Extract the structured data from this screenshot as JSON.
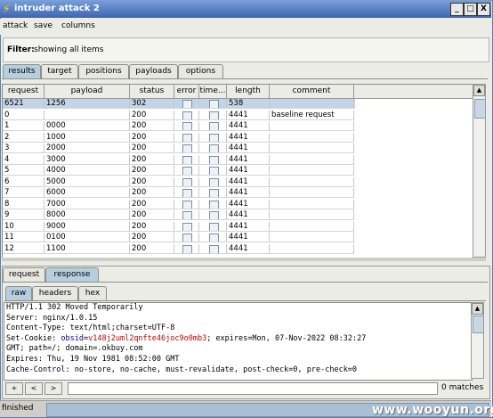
{
  "window": {
    "title": "intruder attack 2",
    "controls": [
      "_",
      "□",
      "X"
    ]
  },
  "menu": [
    "attack",
    "save",
    "columns"
  ],
  "filter": {
    "label": "Filter:",
    "value": "showing all items"
  },
  "top_tabs": [
    "results",
    "target",
    "positions",
    "payloads",
    "options"
  ],
  "active_top_tab": "results",
  "table": {
    "columns": [
      "request",
      "payload",
      "status",
      "error",
      "time...",
      "length",
      "comment"
    ],
    "rows": [
      {
        "request": "6521",
        "payload": "1256",
        "status": "302",
        "length": "538",
        "comment": "",
        "selected": true
      },
      {
        "request": "0",
        "payload": "",
        "status": "200",
        "length": "4441",
        "comment": "baseline request"
      },
      {
        "request": "1",
        "payload": "0000",
        "status": "200",
        "length": "4441",
        "comment": ""
      },
      {
        "request": "2",
        "payload": "1000",
        "status": "200",
        "length": "4441",
        "comment": ""
      },
      {
        "request": "3",
        "payload": "2000",
        "status": "200",
        "length": "4441",
        "comment": ""
      },
      {
        "request": "4",
        "payload": "3000",
        "status": "200",
        "length": "4441",
        "comment": ""
      },
      {
        "request": "5",
        "payload": "4000",
        "status": "200",
        "length": "4441",
        "comment": ""
      },
      {
        "request": "6",
        "payload": "5000",
        "status": "200",
        "length": "4441",
        "comment": ""
      },
      {
        "request": "7",
        "payload": "6000",
        "status": "200",
        "length": "4441",
        "comment": ""
      },
      {
        "request": "8",
        "payload": "7000",
        "status": "200",
        "length": "4441",
        "comment": ""
      },
      {
        "request": "9",
        "payload": "8000",
        "status": "200",
        "length": "4441",
        "comment": ""
      },
      {
        "request": "10",
        "payload": "9000",
        "status": "200",
        "length": "4441",
        "comment": ""
      },
      {
        "request": "11",
        "payload": "0100",
        "status": "200",
        "length": "4441",
        "comment": ""
      },
      {
        "request": "12",
        "payload": "1100",
        "status": "200",
        "length": "4441",
        "comment": ""
      }
    ]
  },
  "lower_tabs": [
    "request",
    "response"
  ],
  "active_lower_tab": "response",
  "view_tabs": [
    "raw",
    "headers",
    "hex"
  ],
  "active_view_tab": "raw",
  "response_lines": [
    {
      "text": "HTTP/1.1 302 Moved Temporarily"
    },
    {
      "text": "Server: nginx/1.0.15"
    },
    {
      "text": "Content-Type: text/html;charset=UTF-8"
    },
    {
      "prefix": "Set-Cookie: ",
      "key": "obsid",
      "eq": "=",
      "value": "v148j2uml2qnfte46joc9o0mb3",
      "suffix": "; expires=Mon, 07-Nov-2022 08:32:27"
    },
    {
      "text": "GMT; path=/; domain=.okbuy.com"
    },
    {
      "text": "Expires: Thu, 19 Nov 1981 08:52:00 GMT"
    },
    {
      "text": "Cache-Control: no-store, no-cache, must-revalidate, post-check=0, pre-check=0"
    }
  ],
  "search": {
    "buttons": [
      "+",
      "<",
      ">"
    ],
    "value": "",
    "matches": "0 matches"
  },
  "status": "finished",
  "watermark": "www.wooyun.org",
  "colors": {
    "selected_row": "#c3d4e8",
    "cookie_name": "#0000a0",
    "cookie_value": "#c00000",
    "titlebar": "#3d66b0"
  }
}
